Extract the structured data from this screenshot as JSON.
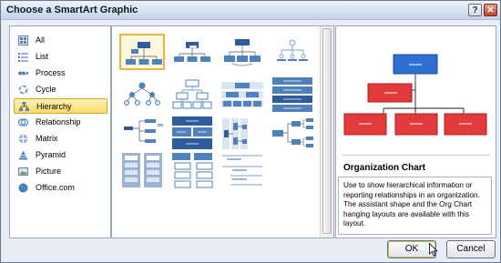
{
  "window": {
    "title": "Choose a SmartArt Graphic",
    "help_label": "?",
    "close_label": "✕"
  },
  "categories": [
    {
      "label": "All",
      "icon": "all-icon",
      "selected": false
    },
    {
      "label": "List",
      "icon": "list-icon",
      "selected": false
    },
    {
      "label": "Process",
      "icon": "process-icon",
      "selected": false
    },
    {
      "label": "Cycle",
      "icon": "cycle-icon",
      "selected": false
    },
    {
      "label": "Hierarchy",
      "icon": "hierarchy-icon",
      "selected": true
    },
    {
      "label": "Relationship",
      "icon": "relationship-icon",
      "selected": false
    },
    {
      "label": "Matrix",
      "icon": "matrix-icon",
      "selected": false
    },
    {
      "label": "Pyramid",
      "icon": "pyramid-icon",
      "selected": false
    },
    {
      "label": "Picture",
      "icon": "picture-icon",
      "selected": false
    },
    {
      "label": "Office.com",
      "icon": "globe-icon",
      "selected": false
    }
  ],
  "layouts": {
    "selected_index": 0,
    "items": [
      "organization-chart",
      "name-and-title-org-chart",
      "half-circle-org-chart",
      "circle-picture-hierarchy",
      "hierarchy",
      "labeled-hierarchy",
      "table-hierarchy",
      "horizontal-multi-level-hierarchy",
      "horizontal-organization-chart",
      "architecture-layout",
      "horizontal-labeled-hierarchy",
      "horizontal-hierarchy",
      "stacked-list",
      "hierarchy-list",
      "lined-list"
    ]
  },
  "preview": {
    "layout_name": "Organization Chart",
    "description": "Use to show hierarchical information or reporting relationships in an organization. The assistant shape and the Org Chart hanging layouts are available with this layout.",
    "colors": {
      "top": "#2f6fcf",
      "red": "#e23a3a",
      "red_border": "#b01e1e"
    }
  },
  "buttons": {
    "ok": "OK",
    "cancel": "Cancel"
  },
  "colors": {
    "accent_blue": "#4f81bd",
    "dark_blue": "#2d5b9c",
    "selection": "#e8b338"
  }
}
